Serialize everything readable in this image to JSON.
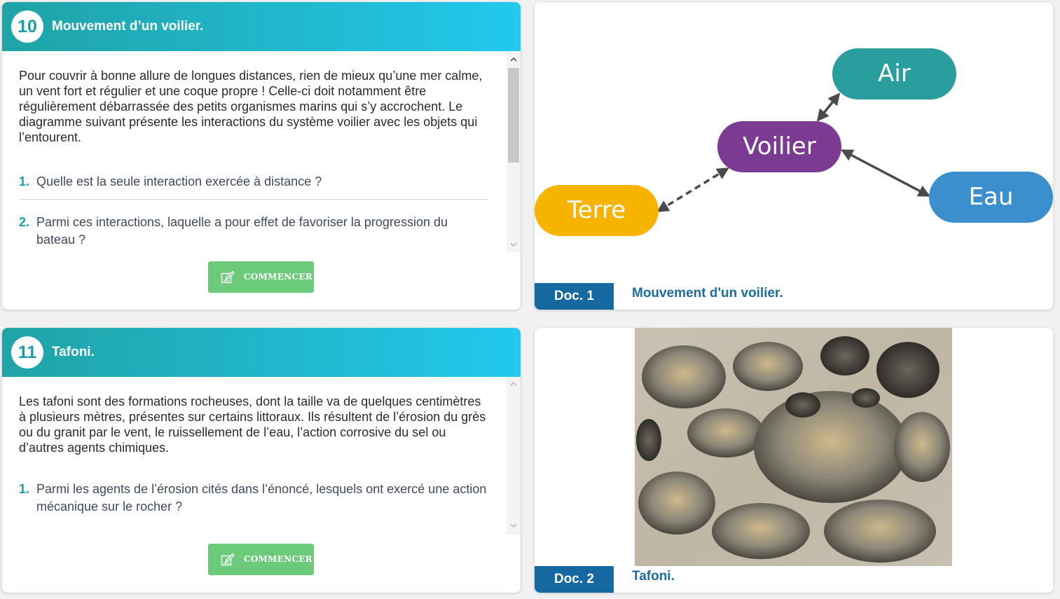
{
  "exercises": [
    {
      "number": "10",
      "title": "Mouvement d’un voilier.",
      "intro": "Pour couvrir à bonne allure de longues distances, rien de mieux qu’une mer calme, un vent fort et régulier et une coque propre ! Celle-ci doit notamment être régulièrement débarrassée des petits organismes marins qui s’y accrochent. Le diagramme suivant présente les interactions du système voilier avec les objets qui l’entourent.",
      "questions": [
        {
          "num": "1.",
          "text": "Quelle est la seule interaction exercée à distance ?"
        },
        {
          "num": "2.",
          "text": "Parmi ces interactions, laquelle a pour effet de favoriser la progression du bateau ?"
        }
      ],
      "button_label": "COMMENCER"
    },
    {
      "number": "11",
      "title": "Tafoni.",
      "intro": "Les tafoni sont des formations rocheuses, dont la taille va de quelques centimètres à plusieurs mètres, présentes sur certains littoraux. Ils résultent de l’érosion du grès ou du granit par le vent, le ruissellement de l’eau, l’action corrosive du sel ou d’autres agents chimiques.",
      "questions": [
        {
          "num": "1.",
          "text": "Parmi les agents de l’érosion cités dans l’énoncé, lesquels ont exercé une action mécanique sur le rocher ?"
        }
      ],
      "button_label": "COMMENCER"
    }
  ],
  "documents": [
    {
      "tag": "Doc. 1",
      "caption": "Mouvement d'un voilier.",
      "diagram": {
        "nodes": {
          "air": "Air",
          "voilier": "Voilier",
          "eau": "Eau",
          "terre": "Terre"
        },
        "colors": {
          "air": "#2a9d9f",
          "voilier": "#7b3b92",
          "eau": "#3b8fcc",
          "terre": "#f6b300",
          "arrow": "#4a4a4a"
        }
      }
    },
    {
      "tag": "Doc. 2",
      "caption": "Tafoni."
    }
  ],
  "icons": {
    "button": "edit-icon",
    "scroll_up": "chevron-up-icon",
    "scroll_down": "chevron-down-icon"
  },
  "colors": {
    "header_start": "#1fa3a6",
    "header_end": "#22c8ee",
    "button": "#6ccb7b",
    "doc_tag": "#1569a0"
  }
}
